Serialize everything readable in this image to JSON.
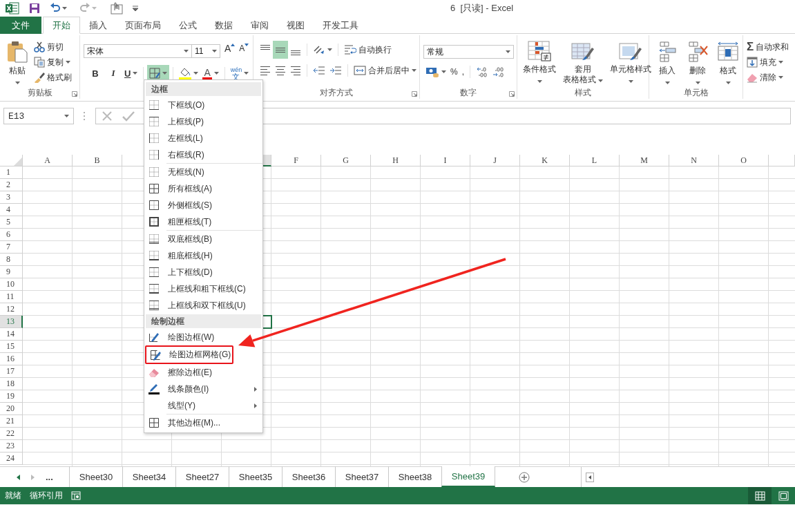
{
  "title_bar": {
    "title": "6  [只读] - Excel"
  },
  "ribbon_tabs": [
    {
      "label": "文件",
      "kind": "file",
      "selected": false
    },
    {
      "label": "开始",
      "kind": "tab",
      "selected": true
    },
    {
      "label": "插入",
      "kind": "tab",
      "selected": false
    },
    {
      "label": "页面布局",
      "kind": "tab",
      "selected": false
    },
    {
      "label": "公式",
      "kind": "tab",
      "selected": false
    },
    {
      "label": "数据",
      "kind": "tab",
      "selected": false
    },
    {
      "label": "审阅",
      "kind": "tab",
      "selected": false
    },
    {
      "label": "视图",
      "kind": "tab",
      "selected": false
    },
    {
      "label": "开发工具",
      "kind": "tab",
      "selected": false
    }
  ],
  "clipboard": {
    "label": "剪贴板",
    "paste": "粘贴",
    "cut": "剪切",
    "copy": "复制",
    "format_painter": "格式刷"
  },
  "font": {
    "name": "宋体",
    "size": "11",
    "grow": "A",
    "shrink": "A",
    "bold": "B",
    "italic": "I",
    "underline": "U",
    "borders_pressed": true,
    "font_color": "A",
    "phonetic_reading": "wén",
    "phonetic_char": "文"
  },
  "alignment": {
    "label": "对齐方式",
    "middle_align_pressed": true,
    "wrap_text": "自动换行",
    "merge_center": "合并后居中"
  },
  "number": {
    "label": "数字",
    "format": "常规",
    "percent": "%",
    "comma": ","
  },
  "styles": {
    "label": "样式",
    "buttons": [
      {
        "lines": [
          "条件格式"
        ],
        "kind": "conditional"
      },
      {
        "lines": [
          "套用",
          "表格格式"
        ],
        "kind": "table"
      },
      {
        "lines": [
          "单元格样式"
        ],
        "kind": "cell"
      }
    ]
  },
  "cells": {
    "label": "单元格",
    "buttons": [
      {
        "label": "插入",
        "kind": "insert"
      },
      {
        "label": "删除",
        "kind": "delete"
      },
      {
        "label": "格式",
        "kind": "format"
      }
    ]
  },
  "editing": {
    "autosum_symbol": "Σ",
    "autosum": "自动求和",
    "fill": "填充",
    "clear": "清除"
  },
  "formula_bar": {
    "name_box": "E13"
  },
  "sheet": {
    "columns": [
      {
        "label": "A",
        "selected": false
      },
      {
        "label": "B",
        "selected": false
      },
      {
        "selected": false
      },
      {},
      {
        "selected": true
      },
      {
        "label": "F",
        "selected": false
      },
      {
        "label": "G",
        "selected": false
      },
      {
        "label": "H",
        "selected": false
      },
      {
        "label": "I",
        "selected": false
      },
      {
        "label": "J",
        "selected": false
      },
      {
        "label": "K",
        "selected": false
      },
      {
        "label": "L",
        "selected": false
      },
      {
        "label": "M",
        "selected": false
      },
      {
        "label": "N",
        "selected": false
      },
      {
        "label": "O",
        "selected": false
      }
    ],
    "rows": [
      {
        "label": "1",
        "selected": false
      },
      {
        "label": "2",
        "selected": false
      },
      {
        "label": "3",
        "selected": false
      },
      {
        "label": "4",
        "selected": false
      },
      {
        "label": "5",
        "selected": false
      },
      {
        "label": "6",
        "selected": false
      },
      {
        "label": "7",
        "selected": false
      },
      {
        "label": "8",
        "selected": false
      },
      {
        "label": "9",
        "selected": false
      },
      {
        "label": "10",
        "selected": false
      },
      {
        "label": "11",
        "selected": false
      },
      {
        "label": "12",
        "selected": false
      },
      {
        "label": "13",
        "selected": true
      },
      {
        "label": "14",
        "selected": false
      },
      {
        "label": "15",
        "selected": false
      },
      {
        "label": "16",
        "selected": false
      },
      {
        "label": "17",
        "selected": false
      },
      {
        "label": "18",
        "selected": false
      },
      {
        "label": "19",
        "selected": false
      },
      {
        "label": "20",
        "selected": false
      },
      {
        "label": "21",
        "selected": false
      },
      {
        "label": "22",
        "selected": false
      },
      {
        "label": "23",
        "selected": false
      },
      {
        "label": "24",
        "selected": false
      }
    ]
  },
  "sheet_tabs": {
    "more": "...",
    "tabs": [
      {
        "label": "Sheet30",
        "selected": false
      },
      {
        "label": "Sheet34",
        "selected": false
      },
      {
        "label": "Sheet27",
        "selected": false
      },
      {
        "label": "Sheet35",
        "selected": false
      },
      {
        "label": "Sheet36",
        "selected": false
      },
      {
        "label": "Sheet37",
        "selected": false
      },
      {
        "label": "Sheet38",
        "selected": false
      },
      {
        "label": "Sheet39",
        "selected": true
      }
    ]
  },
  "status_bar": {
    "ready": "就绪",
    "circular": "循环引用",
    "views": [
      {
        "kind": "normal",
        "selected": true
      },
      {
        "kind": "page_layout",
        "selected": false
      }
    ]
  },
  "border_menu": {
    "sections": [
      {
        "header": "边框",
        "items": [
          {
            "label": "下框线(O)",
            "kind": "bottom",
            "submenu": false,
            "separator_before": false,
            "marked": false
          },
          {
            "label": "上框线(P)",
            "kind": "top",
            "submenu": false,
            "separator_before": false,
            "marked": false
          },
          {
            "label": "左框线(L)",
            "kind": "left",
            "submenu": false,
            "separator_before": false,
            "marked": false
          },
          {
            "label": "右框线(R)",
            "kind": "right",
            "submenu": false,
            "separator_before": false,
            "marked": false
          },
          {
            "label": "无框线(N)",
            "kind": "none",
            "submenu": false,
            "separator_before": true,
            "marked": false
          },
          {
            "label": "所有框线(A)",
            "kind": "all",
            "submenu": false,
            "separator_before": false,
            "marked": false
          },
          {
            "label": "外侧框线(S)",
            "kind": "outside",
            "submenu": false,
            "separator_before": false,
            "marked": false
          },
          {
            "label": "粗匣框线(T)",
            "kind": "thick_box",
            "submenu": false,
            "separator_before": false,
            "marked": false
          },
          {
            "label": "双底框线(B)",
            "kind": "double_bottom",
            "submenu": false,
            "separator_before": true,
            "marked": false
          },
          {
            "label": "粗底框线(H)",
            "kind": "thick_bottom",
            "submenu": false,
            "separator_before": false,
            "marked": false
          },
          {
            "label": "上下框线(D)",
            "kind": "top_bottom",
            "submenu": false,
            "separator_before": false,
            "marked": false
          },
          {
            "label": "上框线和粗下框线(C)",
            "kind": "top_thick_bottom",
            "submenu": false,
            "separator_before": false,
            "marked": false
          },
          {
            "label": "上框线和双下框线(U)",
            "kind": "top_double_bottom",
            "submenu": false,
            "separator_before": false,
            "marked": false
          }
        ]
      },
      {
        "header": "绘制边框",
        "items": [
          {
            "label": "绘图边框(W)",
            "kind": "draw",
            "submenu": false,
            "separator_before": false,
            "marked": false
          },
          {
            "label": "绘图边框网格(G)",
            "kind": "draw_grid",
            "submenu": false,
            "separator_before": false,
            "marked": true
          },
          {
            "label": "擦除边框(E)",
            "kind": "erase",
            "submenu": false,
            "separator_before": false,
            "marked": false
          },
          {
            "label": "线条颜色(I)",
            "kind": "line_color",
            "submenu": true,
            "separator_before": false,
            "marked": false
          },
          {
            "label": "线型(Y)",
            "kind": "line_style",
            "submenu": true,
            "separator_before": false,
            "marked": false
          },
          {
            "label": "其他边框(M)...",
            "kind": "all",
            "submenu": false,
            "separator_before": true,
            "marked": false
          }
        ]
      }
    ]
  }
}
